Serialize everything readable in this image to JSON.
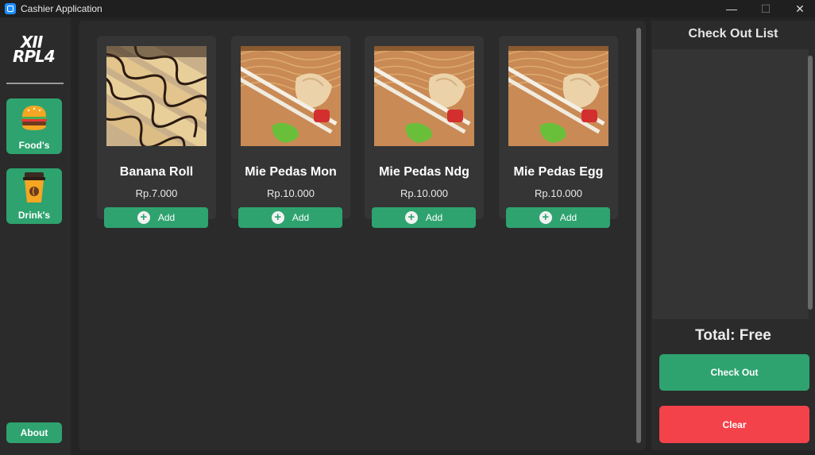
{
  "window": {
    "title": "Cashier Application",
    "controls": {
      "minimize": "—",
      "maximize": "☐",
      "close": "✕"
    }
  },
  "sidebar": {
    "logo_line1": "XII",
    "logo_line2": "RPL4",
    "categories": [
      {
        "label": "Food's",
        "icon": "burger-icon"
      },
      {
        "label": "Drink's",
        "icon": "coffee-cup-icon"
      }
    ],
    "about_label": "About"
  },
  "products": [
    {
      "name": "Banana Roll",
      "price": "Rp.7.000",
      "add_label": "Add",
      "image": "banana-roll-photo"
    },
    {
      "name": "Mie Pedas Mon",
      "price": "Rp.10.000",
      "add_label": "Add",
      "image": "noodle-dumpling-photo"
    },
    {
      "name": "Mie Pedas Ndg",
      "price": "Rp.10.000",
      "add_label": "Add",
      "image": "noodle-dumpling-photo"
    },
    {
      "name": "Mie Pedas Egg",
      "price": "Rp.10.000",
      "add_label": "Add",
      "image": "noodle-dumpling-photo"
    }
  ],
  "checkout": {
    "title": "Check Out List",
    "total": "Total: Free",
    "checkout_label": "Check Out",
    "clear_label": "Clear"
  },
  "colors": {
    "accent_green": "#2ea36f",
    "danger_red": "#f4424a",
    "panel": "#2b2b2b",
    "card": "#353535"
  }
}
